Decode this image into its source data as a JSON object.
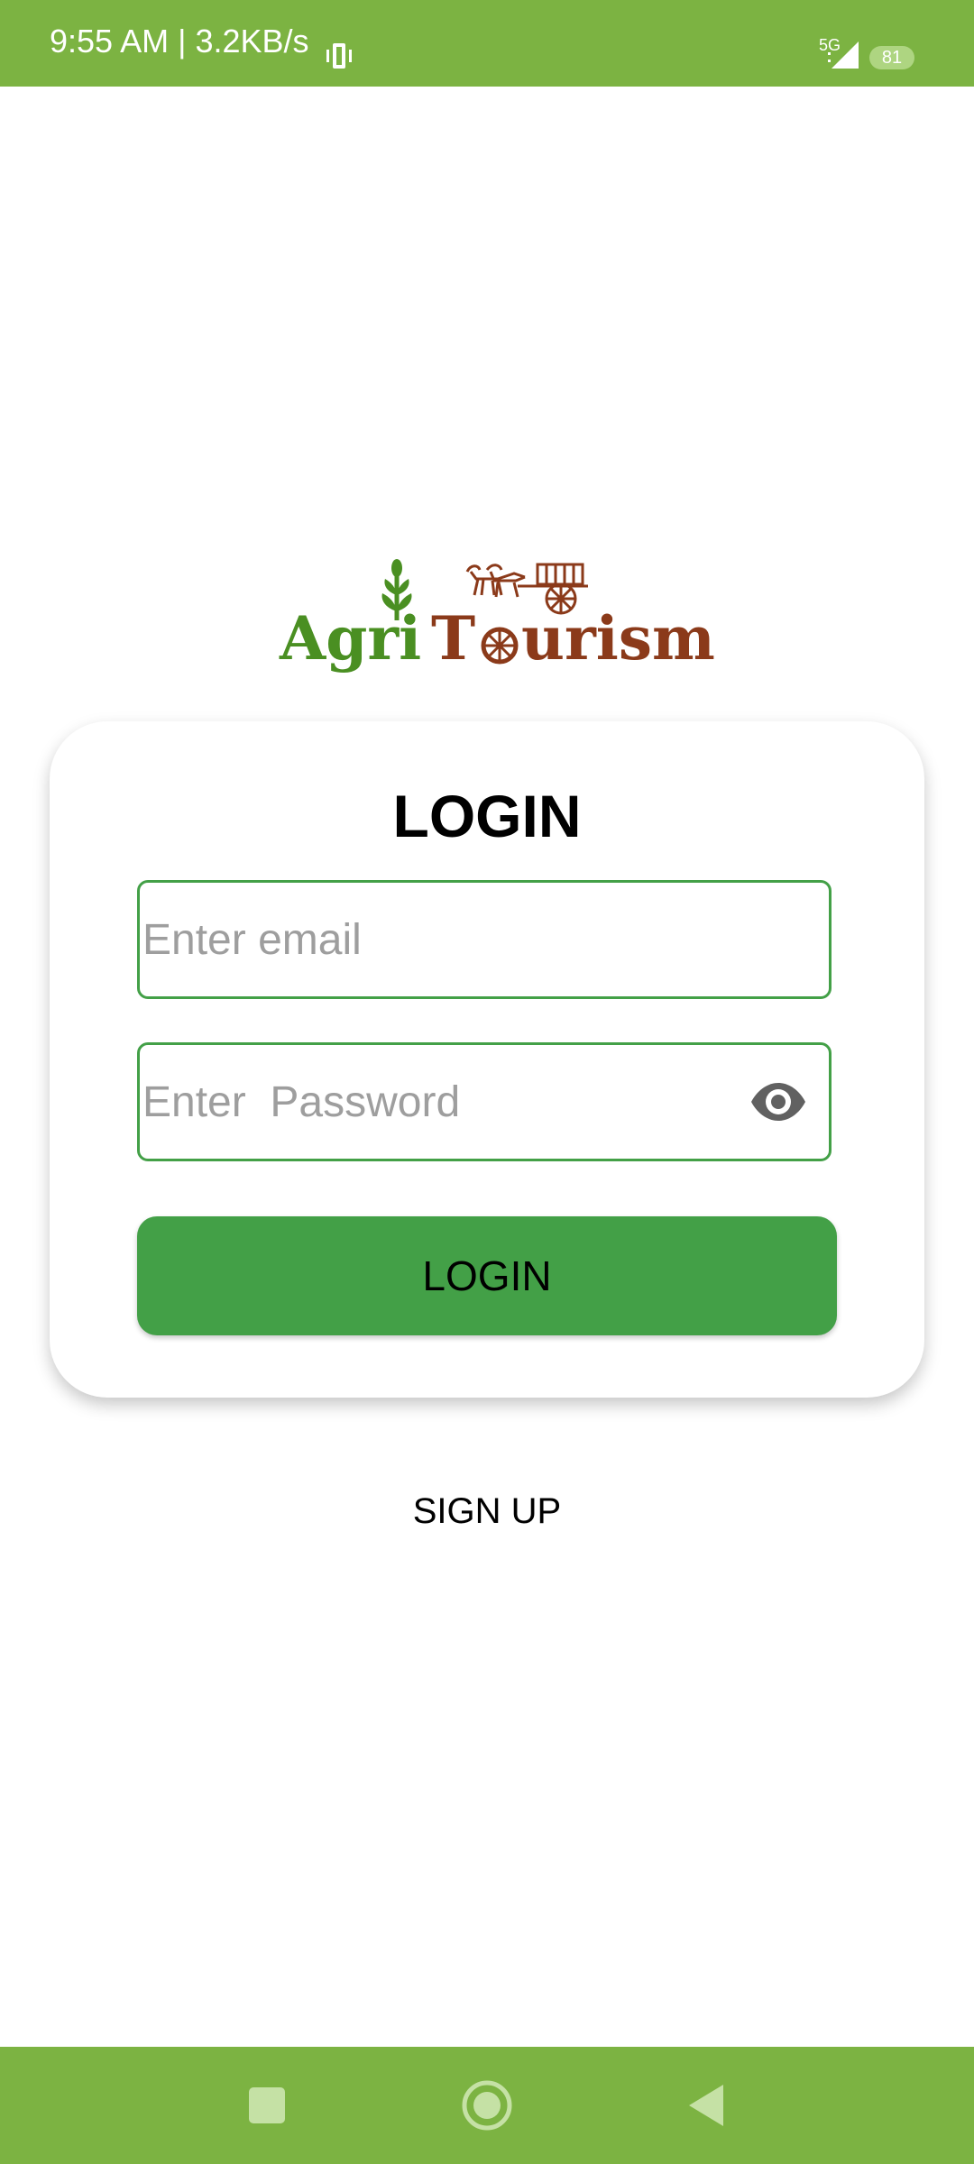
{
  "status_bar": {
    "time": "9:55 AM | 3.2KB/s",
    "network": "5G",
    "battery": "81"
  },
  "logo": {
    "word_left": "Agri",
    "word_right_first": "T",
    "word_right_rest": "urism"
  },
  "login_card": {
    "title": "LOGIN",
    "email_placeholder": "Enter email",
    "password_placeholder": "Enter  Password",
    "login_button": "LOGIN"
  },
  "signup_link": "SIGN UP",
  "colors": {
    "bar_green": "#7cb342",
    "accent_green": "#43a047",
    "logo_green": "#4a8f22",
    "logo_brown": "#8b3a1a"
  },
  "icons": {
    "status": [
      "vibrate-icon",
      "signal-icon",
      "battery-icon"
    ],
    "password_toggle": "eye-icon",
    "navigation": [
      "square-recents-icon",
      "circle-home-icon",
      "triangle-back-icon"
    ]
  }
}
